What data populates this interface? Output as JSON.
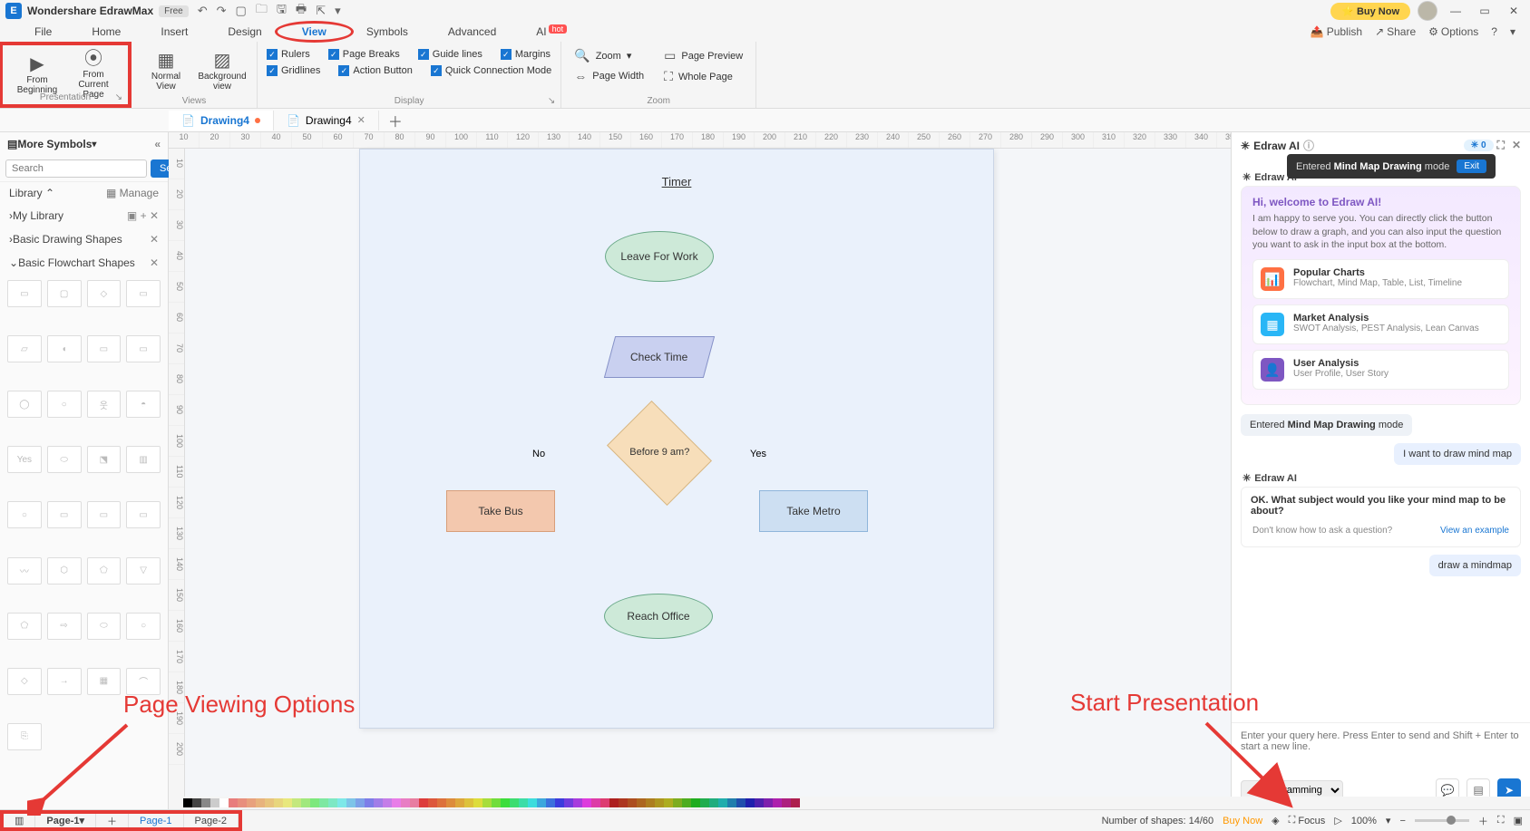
{
  "app": {
    "name": "Wondershare EdrawMax",
    "edition": "Free"
  },
  "titlebar_right": {
    "buy": "⭐ Buy Now"
  },
  "menu": {
    "items": [
      "File",
      "Home",
      "Insert",
      "Design",
      "View",
      "Symbols",
      "Advanced",
      "AI"
    ],
    "active": "View",
    "ai_badge": "hot",
    "right": {
      "publish": "Publish",
      "share": "Share",
      "options": "Options"
    }
  },
  "ribbon": {
    "presentation": {
      "from_beginning": "From Beginning",
      "from_current": "From Current Page",
      "title": "Presentation"
    },
    "views": {
      "normal": "Normal View",
      "background": "Background view",
      "title": "Views"
    },
    "display": {
      "rulers": "Rulers",
      "page_breaks": "Page Breaks",
      "guide_lines": "Guide lines",
      "margins": "Margins",
      "gridlines": "Gridlines",
      "action_button": "Action Button",
      "quick_conn": "Quick Connection Mode",
      "title": "Display"
    },
    "zoom": {
      "zoom": "Zoom",
      "page_width": "Page Width",
      "page_preview": "Page Preview",
      "whole_page": "Whole Page",
      "title": "Zoom"
    }
  },
  "tabs": {
    "active": "Drawing4",
    "second": "Drawing4"
  },
  "sidebar": {
    "title": "More Symbols",
    "search_ph": "Search",
    "search_btn": "Search",
    "library": "Library",
    "manage": "Manage",
    "my_library": "My Library",
    "sec1": "Basic Drawing Shapes",
    "sec2": "Basic Flowchart Shapes"
  },
  "flow": {
    "title": "Timer",
    "leave": "Leave For Work",
    "check": "Check Time",
    "decision": "Before 9 am?",
    "no": "No",
    "yes": "Yes",
    "bus": "Take Bus",
    "metro": "Take Metro",
    "reach": "Reach Office"
  },
  "ai": {
    "panel_title": "Edraw AI",
    "credit": "0",
    "edraw_name": "Edraw AI",
    "toast_pre": "Entered ",
    "toast_bold": "Mind Map Drawing",
    "toast_post": " mode",
    "exit": "Exit",
    "welcome_pre": "Hi, welcome to ",
    "welcome_hl": "Edraw AI!",
    "welcome_body": "I am happy to serve you. You can directly click the button below to draw a graph, and you can also input the question you want to ask in the input box at the bottom.",
    "sug1_t": "Popular Charts",
    "sug1_s": "Flowchart, Mind Map, Table, List, Timeline",
    "sug2_t": "Market Analysis",
    "sug2_s": "SWOT Analysis, PEST Analysis, Lean Canvas",
    "sug3_t": "User Analysis",
    "sug3_s": "User Profile, User Story",
    "sys1_pre": "Entered ",
    "sys1_b": "Mind Map Drawing",
    "sys1_post": " mode",
    "user1": "I want to draw mind map",
    "ai_reply": "OK. What subject would you like your mind map to be about?",
    "hint_q": "Don't know how to ask a question?",
    "hint_link": "View an example",
    "user2": "draw a mindmap",
    "input_ph": "Enter your query here. Press Enter to send and Shift + Enter to start a new line.",
    "mode": "AI Diagramming"
  },
  "status": {
    "page_sel": "Page-1",
    "p1": "Page-1",
    "p2": "Page-2",
    "shapes": "Number of shapes: 14/60",
    "buy": "Buy Now",
    "focus": "Focus",
    "zoom": "100%"
  },
  "anno": {
    "left": "Page Viewing Options",
    "right": "Start Presentation"
  }
}
